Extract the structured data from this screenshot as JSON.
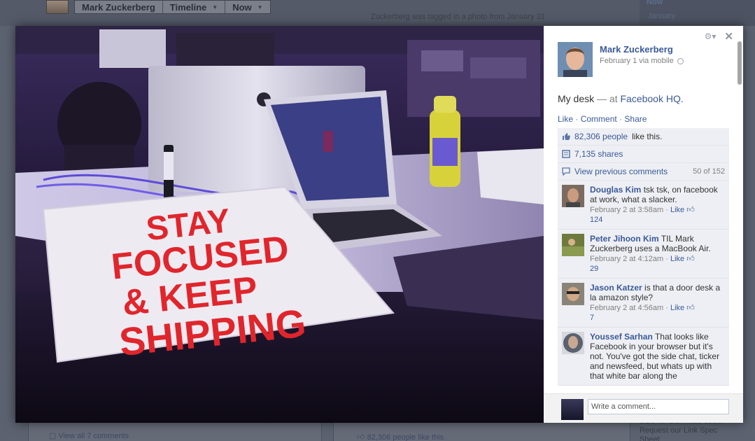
{
  "background": {
    "tabs": [
      {
        "label": "Mark Zuckerberg"
      },
      {
        "label": "Timeline"
      },
      {
        "label": "Now"
      }
    ],
    "activity_text": "Zuckerberg was tagged in a photo from January 31",
    "nav_now": "Now",
    "nav_january": "January",
    "view_all_comments": "View all 7 comments",
    "likes_text": "82,306 people like this.",
    "sidebar_snippet": "SEO for Dummies book. Request our Link Spec Sheet"
  },
  "viewer": {
    "photo_sign": {
      "line1": "STAY",
      "line2": "FOCUSED",
      "line3": "& KEEP",
      "line4": "SHIPPING"
    },
    "author": {
      "name": "Mark Zuckerberg",
      "date": "February 1",
      "via": "via mobile"
    },
    "caption": {
      "text": "My desk",
      "dash": "—",
      "at": "at",
      "place": "Facebook HQ."
    },
    "actions": {
      "like": "Like",
      "comment": "Comment",
      "share": "Share",
      "sep": "·"
    },
    "ufi": {
      "likes_link": "82,306 people",
      "likes_suffix": "like this.",
      "shares": "7,135 shares",
      "view_previous": "View previous comments",
      "comment_count": "50 of 152"
    },
    "comments": [
      {
        "name": "Douglas Kim",
        "text": "tsk tsk, on facebook at work, what a slacker.",
        "time": "February 2 at 3:58am",
        "like": "Like",
        "likes": "124"
      },
      {
        "name": "Peter Jihoon Kim",
        "text": "TIL Mark Zuckerberg uses a MacBook Air.",
        "time": "February 2 at 4:12am",
        "like": "Like",
        "likes": "29"
      },
      {
        "name": "Jason Katzer",
        "text": "is that a door desk a la amazon style?",
        "time": "February 2 at 4:56am",
        "like": "Like",
        "likes": "7"
      },
      {
        "name": "Youssef Sarhan",
        "text": "That looks like Facebook in your browser but it's not. You've got the side chat, ticker and newsfeed, but whats up with that white bar along the",
        "time": "",
        "like": "",
        "likes": ""
      }
    ],
    "write_placeholder": "Write a comment...",
    "colors": {
      "link": "#3b5998",
      "ufi_bg": "#edeff4",
      "sign_red": "#e0262c"
    }
  }
}
